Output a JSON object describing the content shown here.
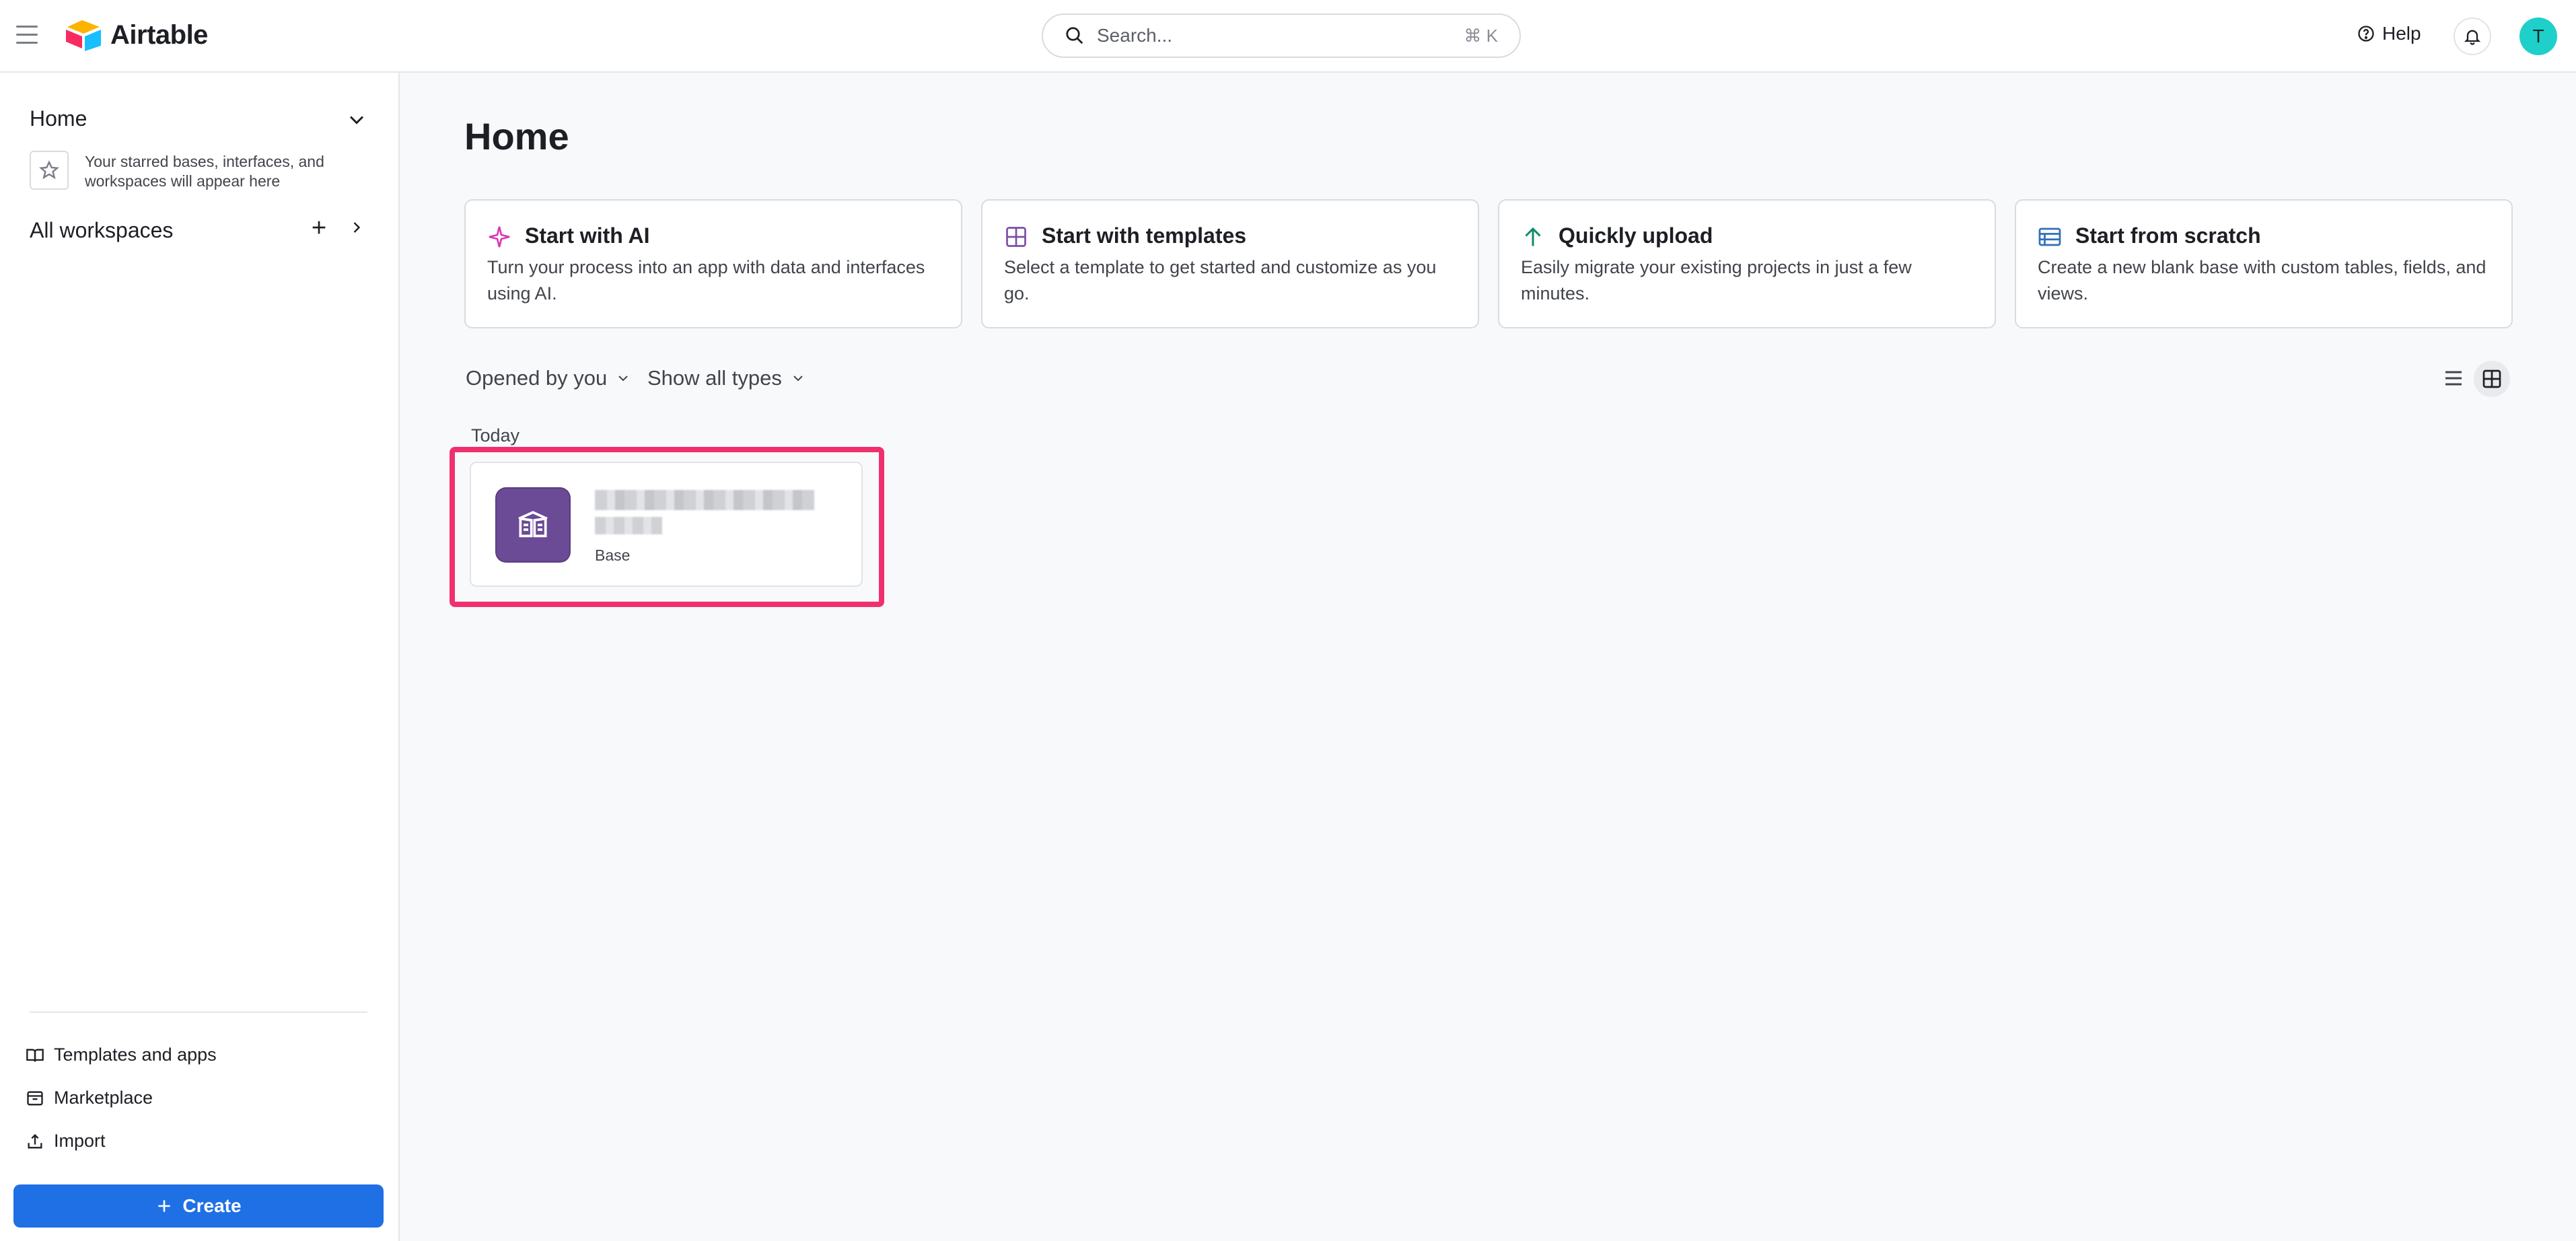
{
  "app": {
    "logo_text": "Airtable"
  },
  "search": {
    "placeholder": "Search...",
    "shortcut": "⌘ K"
  },
  "header": {
    "help_label": "Help",
    "avatar_initial": "T"
  },
  "sidebar": {
    "home_label": "Home",
    "starred_note": "Your starred bases, interfaces, and workspaces will appear here",
    "workspaces_label": "All workspaces",
    "links": [
      {
        "label": "Templates and apps",
        "icon": "book-icon"
      },
      {
        "label": "Marketplace",
        "icon": "store-icon"
      },
      {
        "label": "Import",
        "icon": "upload-icon"
      }
    ],
    "create_label": "Create"
  },
  "main": {
    "title": "Home",
    "cards": [
      {
        "title": "Start with AI",
        "desc": "Turn your process into an app with data and interfaces using AI.",
        "icon": "sparkle-icon",
        "color": "#d63bb8"
      },
      {
        "title": "Start with templates",
        "desc": "Select a template to get started and customize as you go.",
        "icon": "grid-icon",
        "color": "#7b4fa8"
      },
      {
        "title": "Quickly upload",
        "desc": "Easily migrate your existing projects in just a few minutes.",
        "icon": "arrow-up-icon",
        "color": "#0f8a6c"
      },
      {
        "title": "Start from scratch",
        "desc": "Create a new blank base with custom tables, fields, and views.",
        "icon": "table-icon",
        "color": "#2f6fb8"
      }
    ],
    "filters": {
      "opened_by": "Opened by you",
      "types": "Show all types"
    },
    "section_today": "Today",
    "base": {
      "type_label": "Base",
      "icon_color": "#6b4a96"
    }
  },
  "colors": {
    "accent": "#1f6fe5",
    "highlight": "#f0306e",
    "avatar": "#1fcfc9"
  }
}
